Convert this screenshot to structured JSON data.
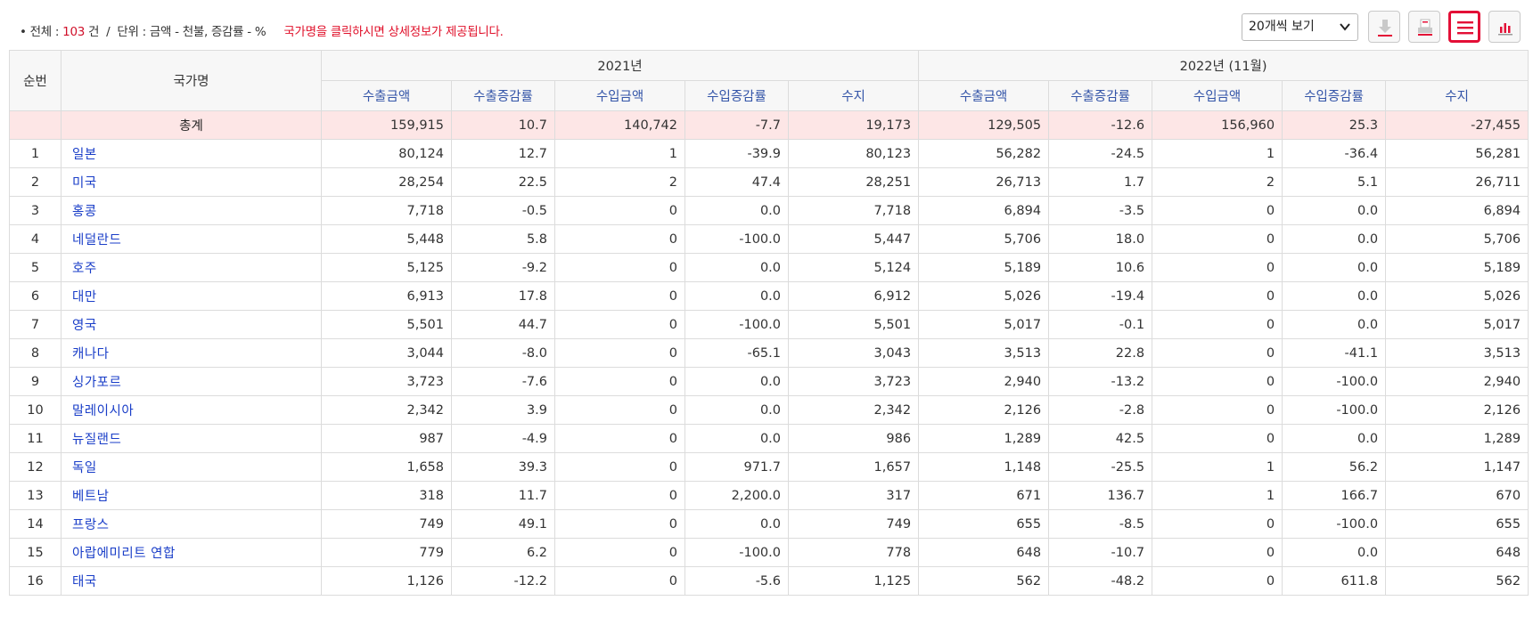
{
  "summary": {
    "bullet": "•",
    "total_label": "전체",
    "colon1": ":",
    "total_count": "103",
    "count_unit": "건",
    "slash": "/",
    "unit_label": "단위",
    "colon2": ":",
    "unit_value": "금액 - 천불, 증감률 - %",
    "notice": "국가명을 클릭하시면 상세정보가 제공됩니다."
  },
  "toolbar": {
    "page_size_value": "20개씩 보기",
    "icons": [
      "excel-download-icon",
      "print-icon",
      "list-view-icon",
      "chart-view-icon"
    ],
    "accent_color": "#e30f36"
  },
  "table": {
    "header": {
      "no": "순번",
      "country": "국가명",
      "group_2021": "2021년",
      "group_2022": "2022년 (11월)",
      "cols": [
        "수출금액",
        "수출증감률",
        "수입금액",
        "수입증감률",
        "수지",
        "수출금액",
        "수출증감률",
        "수입금액",
        "수입증감률",
        "수지"
      ]
    },
    "total": {
      "name": "총계",
      "values": [
        "159,915",
        "10.7",
        "140,742",
        "-7.7",
        "19,173",
        "129,505",
        "-12.6",
        "156,960",
        "25.3",
        "-27,455"
      ]
    },
    "rows": [
      {
        "no": "1",
        "name": "일본",
        "v": [
          "80,124",
          "12.7",
          "1",
          "-39.9",
          "80,123",
          "56,282",
          "-24.5",
          "1",
          "-36.4",
          "56,281"
        ]
      },
      {
        "no": "2",
        "name": "미국",
        "v": [
          "28,254",
          "22.5",
          "2",
          "47.4",
          "28,251",
          "26,713",
          "1.7",
          "2",
          "5.1",
          "26,711"
        ]
      },
      {
        "no": "3",
        "name": "홍콩",
        "v": [
          "7,718",
          "-0.5",
          "0",
          "0.0",
          "7,718",
          "6,894",
          "-3.5",
          "0",
          "0.0",
          "6,894"
        ]
      },
      {
        "no": "4",
        "name": "네덜란드",
        "v": [
          "5,448",
          "5.8",
          "0",
          "-100.0",
          "5,447",
          "5,706",
          "18.0",
          "0",
          "0.0",
          "5,706"
        ]
      },
      {
        "no": "5",
        "name": "호주",
        "v": [
          "5,125",
          "-9.2",
          "0",
          "0.0",
          "5,124",
          "5,189",
          "10.6",
          "0",
          "0.0",
          "5,189"
        ]
      },
      {
        "no": "6",
        "name": "대만",
        "v": [
          "6,913",
          "17.8",
          "0",
          "0.0",
          "6,912",
          "5,026",
          "-19.4",
          "0",
          "0.0",
          "5,026"
        ]
      },
      {
        "no": "7",
        "name": "영국",
        "v": [
          "5,501",
          "44.7",
          "0",
          "-100.0",
          "5,501",
          "5,017",
          "-0.1",
          "0",
          "0.0",
          "5,017"
        ]
      },
      {
        "no": "8",
        "name": "캐나다",
        "v": [
          "3,044",
          "-8.0",
          "0",
          "-65.1",
          "3,043",
          "3,513",
          "22.8",
          "0",
          "-41.1",
          "3,513"
        ]
      },
      {
        "no": "9",
        "name": "싱가포르",
        "v": [
          "3,723",
          "-7.6",
          "0",
          "0.0",
          "3,723",
          "2,940",
          "-13.2",
          "0",
          "-100.0",
          "2,940"
        ]
      },
      {
        "no": "10",
        "name": "말레이시아",
        "v": [
          "2,342",
          "3.9",
          "0",
          "0.0",
          "2,342",
          "2,126",
          "-2.8",
          "0",
          "-100.0",
          "2,126"
        ]
      },
      {
        "no": "11",
        "name": "뉴질랜드",
        "v": [
          "987",
          "-4.9",
          "0",
          "0.0",
          "986",
          "1,289",
          "42.5",
          "0",
          "0.0",
          "1,289"
        ]
      },
      {
        "no": "12",
        "name": "독일",
        "v": [
          "1,658",
          "39.3",
          "0",
          "971.7",
          "1,657",
          "1,148",
          "-25.5",
          "1",
          "56.2",
          "1,147"
        ]
      },
      {
        "no": "13",
        "name": "베트남",
        "v": [
          "318",
          "11.7",
          "0",
          "2,200.0",
          "317",
          "671",
          "136.7",
          "1",
          "166.7",
          "670"
        ]
      },
      {
        "no": "14",
        "name": "프랑스",
        "v": [
          "749",
          "49.1",
          "0",
          "0.0",
          "749",
          "655",
          "-8.5",
          "0",
          "-100.0",
          "655"
        ]
      },
      {
        "no": "15",
        "name": "아랍에미리트 연합",
        "v": [
          "779",
          "6.2",
          "0",
          "-100.0",
          "778",
          "648",
          "-10.7",
          "0",
          "0.0",
          "648"
        ]
      },
      {
        "no": "16",
        "name": "태국",
        "v": [
          "1,126",
          "-12.2",
          "0",
          "-5.6",
          "1,125",
          "562",
          "-48.2",
          "0",
          "611.8",
          "562"
        ]
      }
    ]
  }
}
